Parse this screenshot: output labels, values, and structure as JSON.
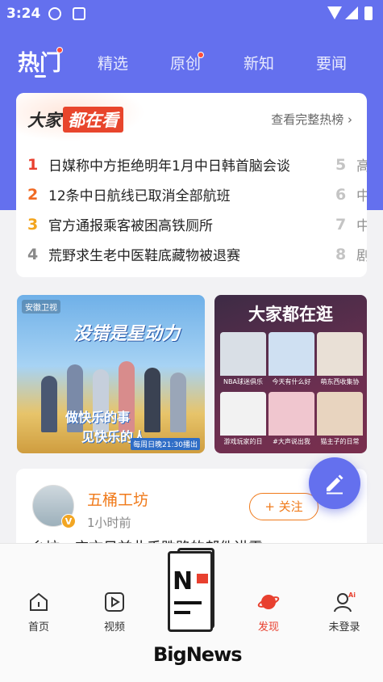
{
  "status_bar": {
    "time": "3:24"
  },
  "tabs": [
    {
      "label": "热门",
      "active": true,
      "dot": true
    },
    {
      "label": "精选",
      "active": false,
      "dot": false
    },
    {
      "label": "原创",
      "active": false,
      "dot": true
    },
    {
      "label": "新知",
      "active": false,
      "dot": false
    },
    {
      "label": "要闻",
      "active": false,
      "dot": false
    }
  ],
  "hot_card": {
    "brand_part1": "大家",
    "brand_part2": "都在看",
    "see_all": "查看完整热榜 ›",
    "items": [
      {
        "rank": "1",
        "title": "日媒称中方拒绝明年1月中日韩首脑会谈"
      },
      {
        "rank": "2",
        "title": "12条中日航线已取消全部航班"
      },
      {
        "rank": "3",
        "title": "官方通报乘客被困高铁厕所"
      },
      {
        "rank": "4",
        "title": "荒野求生老中医鞋底藏物被退赛"
      }
    ],
    "peek_items": [
      {
        "rank": "5",
        "title": "高"
      },
      {
        "rank": "6",
        "title": "中"
      },
      {
        "rank": "7",
        "title": "中"
      },
      {
        "rank": "8",
        "title": "剧"
      }
    ]
  },
  "banner_left": {
    "station": "安徽卫视",
    "title": "没错是星动力",
    "slogan1": "做快乐的事",
    "slogan2": "见快乐的人",
    "airtime": "每周日晚21:30播出"
  },
  "banner_right": {
    "title": "大家都在逛",
    "cells": [
      {
        "caption": "NBA球迷俱乐",
        "color": "#d9dfe6"
      },
      {
        "caption": "今天有什么好",
        "color": "#cfe0f2"
      },
      {
        "caption": "萌东西收集协",
        "color": "#e9e0d6"
      },
      {
        "caption": "游戏玩家的日",
        "color": "#f2f2f2"
      },
      {
        "caption": "#大声说出我",
        "color": "#f0c6cf"
      },
      {
        "caption": "猫主子的日常",
        "color": "#e8d4bf"
      }
    ]
  },
  "feed": {
    "author": "五桶工坊",
    "badge": "V",
    "time": "1小时前",
    "follow_label": "+ 关注",
    "article_title": "乡坊，应文日前此乎跌路的郝件讲需"
  },
  "bottom_nav": [
    {
      "label": "首页",
      "icon": "home-icon",
      "active": false
    },
    {
      "label": "视频",
      "icon": "video-icon",
      "active": false
    },
    {
      "label": "发现",
      "icon": "discover-planet-icon",
      "active": true
    },
    {
      "label": "未登录",
      "icon": "user-ai-icon",
      "active": false
    }
  ],
  "watermark": {
    "label": "BigNews"
  },
  "colors": {
    "header_bg": "#6470ee",
    "accent_red": "#e8402f",
    "accent_orange": "#f07a1a"
  }
}
